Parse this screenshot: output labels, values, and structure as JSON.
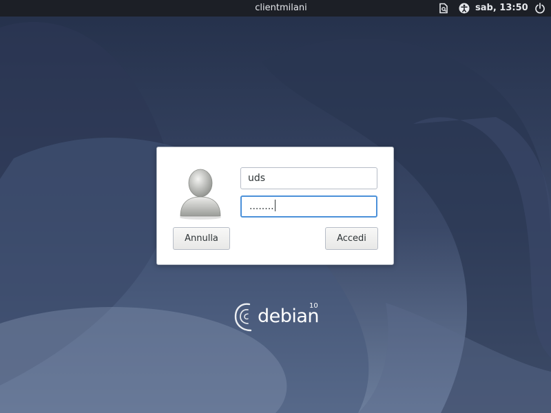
{
  "topbar": {
    "hostname": "clientmilani",
    "clock": "sab, 13:50",
    "icons": [
      "document-search-icon",
      "accessibility-icon",
      "power-icon"
    ]
  },
  "login": {
    "username": "uds",
    "password_mask": "........",
    "cancel_label": "Annulla",
    "login_label": "Accedi"
  },
  "branding": {
    "logo_text": "debian",
    "logo_version": "10"
  },
  "colors": {
    "topbar_bg": "#1c1f26",
    "wallpaper_base": "#33415f",
    "focus_ring": "#4a90d9"
  }
}
